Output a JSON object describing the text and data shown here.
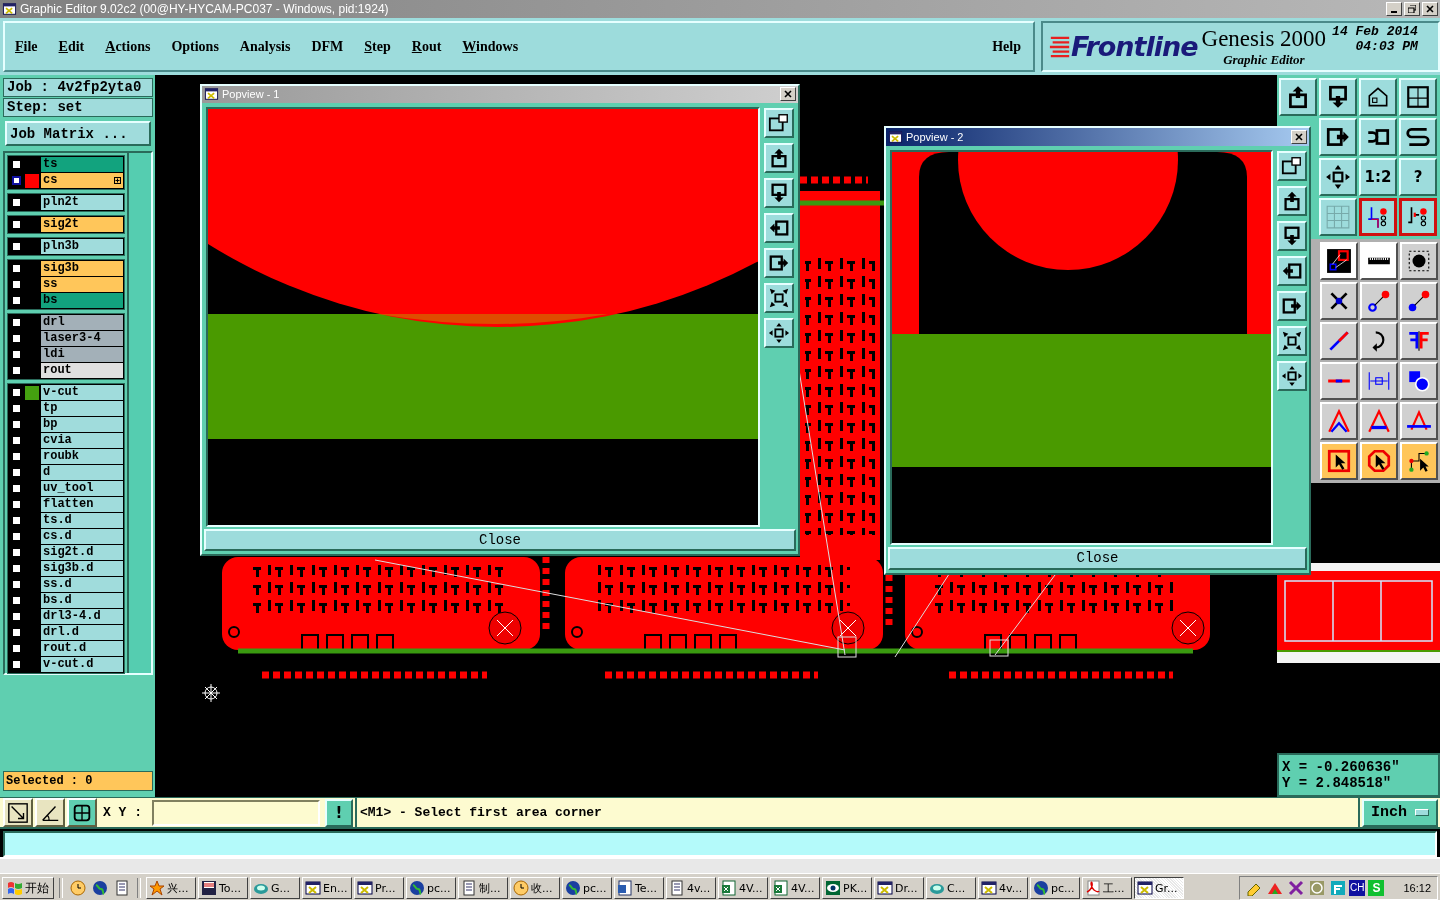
{
  "window": {
    "title": "Graphic Editor 9.02c2 (00@HY-HYCAM-PC037 - Windows, pid:1924)"
  },
  "menu": [
    {
      "label": "File",
      "mnemonic": true
    },
    {
      "label": "Edit",
      "mnemonic": true
    },
    {
      "label": "Actions",
      "mnemonic": true
    },
    {
      "label": "Options",
      "mnemonic": false
    },
    {
      "label": "Analysis",
      "mnemonic": false
    },
    {
      "label": "DFM",
      "mnemonic": false
    },
    {
      "label": "Step",
      "mnemonic": true
    },
    {
      "label": "Rout",
      "mnemonic": true
    },
    {
      "label": "Windows",
      "mnemonic": true
    }
  ],
  "help": "Help",
  "logo": {
    "brand": "Frontline",
    "product": "Genesis 2000",
    "subtitle": "Graphic Editor",
    "date": "14 Feb 2014",
    "time": "04:03 PM"
  },
  "job": {
    "job": "Job : 4v2fp2yta0",
    "step": "Step: set",
    "matrix_button": "Job Matrix ..."
  },
  "layer_groups": [
    {
      "layers": [
        {
          "name": "ts",
          "color": "#12a37e",
          "selected": false
        },
        {
          "name": "cs",
          "color": "#ffc65a",
          "selected": true,
          "swatch": {
            "color": "#ff0000"
          }
        }
      ]
    },
    {
      "layers": [
        {
          "name": "pln2t",
          "color": "#a0dcdc",
          "selected": false
        }
      ]
    },
    {
      "layers": [
        {
          "name": "sig2t",
          "color": "#ffc65a",
          "selected": false
        }
      ]
    },
    {
      "layers": [
        {
          "name": "pln3b",
          "color": "#a0dcdc",
          "selected": false
        }
      ]
    },
    {
      "layers": [
        {
          "name": "sig3b",
          "color": "#ffc65a",
          "selected": false
        },
        {
          "name": "ss",
          "color": "#ffc65a",
          "selected": false
        },
        {
          "name": "bs",
          "color": "#12a37e",
          "selected": false
        }
      ]
    },
    {
      "layers": [
        {
          "name": "drl",
          "color": "#a3b0b8",
          "selected": false
        },
        {
          "name": "laser3-4",
          "color": "#a3b0b8",
          "selected": false
        },
        {
          "name": "ldi",
          "color": "#a3b0b8",
          "selected": false
        },
        {
          "name": "rout",
          "color": "#e0e0e0",
          "selected": false
        }
      ]
    },
    {
      "layers": [
        {
          "name": "v-cut",
          "color": "#a0dcdc",
          "selected": false,
          "swatch": {
            "color": "#44a010"
          }
        },
        {
          "name": "tp",
          "color": "#a0dcdc",
          "selected": false
        },
        {
          "name": "bp",
          "color": "#a0dcdc",
          "selected": false
        },
        {
          "name": "cvia",
          "color": "#a0dcdc",
          "selected": false
        },
        {
          "name": "roubk",
          "color": "#a0dcdc",
          "selected": false
        },
        {
          "name": "d",
          "color": "#a0dcdc",
          "selected": false
        },
        {
          "name": "uv_tool",
          "color": "#a0dcdc",
          "selected": false
        },
        {
          "name": "flatten",
          "color": "#a0dcdc",
          "selected": false
        },
        {
          "name": "ts.d",
          "color": "#a0dcdc",
          "selected": false
        },
        {
          "name": "cs.d",
          "color": "#a0dcdc",
          "selected": false
        },
        {
          "name": "sig2t.d",
          "color": "#a0dcdc",
          "selected": false
        },
        {
          "name": "sig3b.d",
          "color": "#a0dcdc",
          "selected": false
        },
        {
          "name": "ss.d",
          "color": "#a0dcdc",
          "selected": false
        },
        {
          "name": "bs.d",
          "color": "#a0dcdc",
          "selected": false
        },
        {
          "name": "drl3-4.d",
          "color": "#a0dcdc",
          "selected": false
        },
        {
          "name": "drl.d",
          "color": "#a0dcdc",
          "selected": false
        },
        {
          "name": "rout.d",
          "color": "#a0dcdc",
          "selected": false
        },
        {
          "name": "v-cut.d",
          "color": "#a0dcdc",
          "selected": false
        }
      ]
    }
  ],
  "selected_count": "Selected : 0",
  "popviews": [
    {
      "title": "Popview - 1",
      "active": false,
      "close": "Close"
    },
    {
      "title": "Popview - 2",
      "active": true,
      "close": "Close"
    }
  ],
  "tool_labels": {
    "scale": "1:2",
    "help": "?"
  },
  "coordinates": {
    "x": "X = -0.260636\"",
    "y": "Y = 2.848518\""
  },
  "command": {
    "xy_label": "X Y :",
    "alert": "!",
    "message": "<M1> - Select first area corner",
    "units": "Inch"
  },
  "taskbar": {
    "start": "开始",
    "tasks": [
      {
        "label": "兴...",
        "selected": false
      },
      {
        "label": "To...",
        "selected": false
      },
      {
        "label": "G...",
        "selected": false
      },
      {
        "label": "En...",
        "selected": false
      },
      {
        "label": "Pr...",
        "selected": false
      },
      {
        "label": "pc...",
        "selected": false
      },
      {
        "label": "制...",
        "selected": false
      },
      {
        "label": "收...",
        "selected": false
      },
      {
        "label": "pc...",
        "selected": false
      },
      {
        "label": "Te...",
        "selected": false
      },
      {
        "label": "4v...",
        "selected": false
      },
      {
        "label": "4V...",
        "selected": false
      },
      {
        "label": "4V...",
        "selected": false
      },
      {
        "label": "PK...",
        "selected": false
      },
      {
        "label": "Dr...",
        "selected": false
      },
      {
        "label": "C...",
        "selected": false
      },
      {
        "label": "4v...",
        "selected": false
      },
      {
        "label": "pc...",
        "selected": false
      },
      {
        "label": "工...",
        "selected": false
      },
      {
        "label": "Gr...",
        "selected": true
      }
    ],
    "input_indicator": "CH",
    "tray_s": "S",
    "clock": "16:12"
  }
}
